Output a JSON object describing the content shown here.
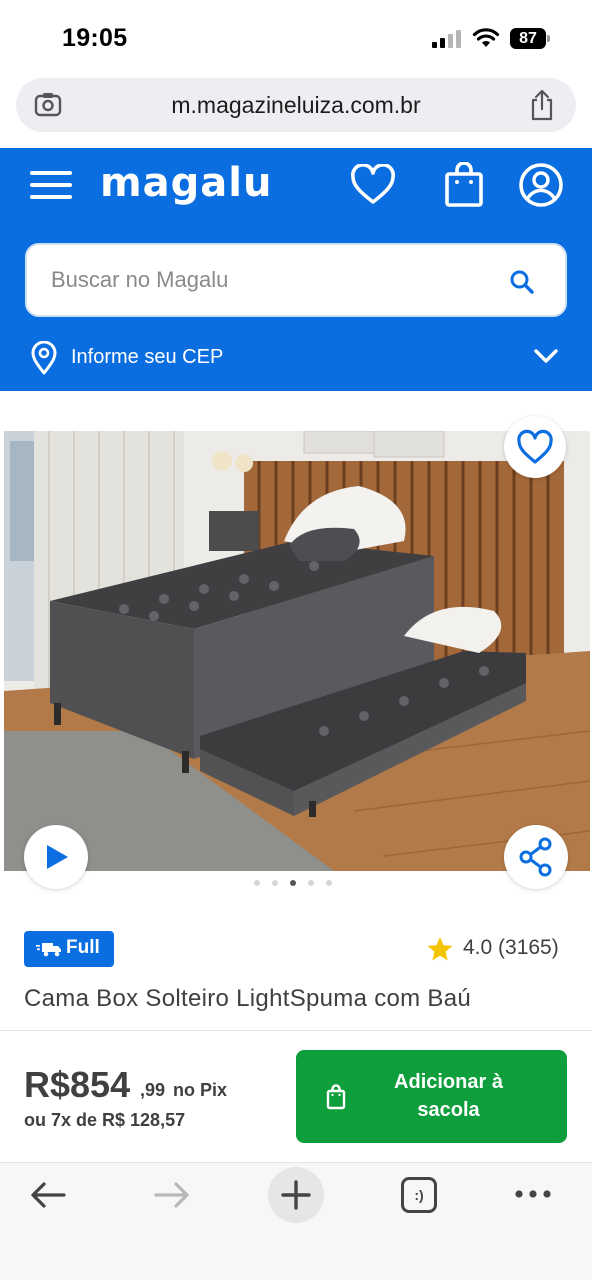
{
  "status_bar": {
    "time": "19:05",
    "battery": "87"
  },
  "browser": {
    "url": "m.magazineluiza.com.br"
  },
  "header": {
    "logo": "magalu",
    "search_placeholder": "Buscar no Magalu",
    "cep_label": "Informe seu CEP"
  },
  "product": {
    "badge": "Full",
    "rating": "4.0 (3165)",
    "title": "Cama Box Solteiro LightSpuma com Baú",
    "carousel": {
      "count": 5,
      "active_index": 2
    }
  },
  "buy_bar": {
    "price_main": "R$854",
    "price_cents": ",99",
    "price_suffix": "no Pix",
    "installment": "ou 7x de R$ 128,57",
    "add_button": "Adicionar à sacola"
  },
  "toolbar": {
    "tabs_label": ":)"
  },
  "colors": {
    "brand_blue": "#0a6ee0",
    "buy_green": "#0e9e3b",
    "star": "#f5c400"
  }
}
